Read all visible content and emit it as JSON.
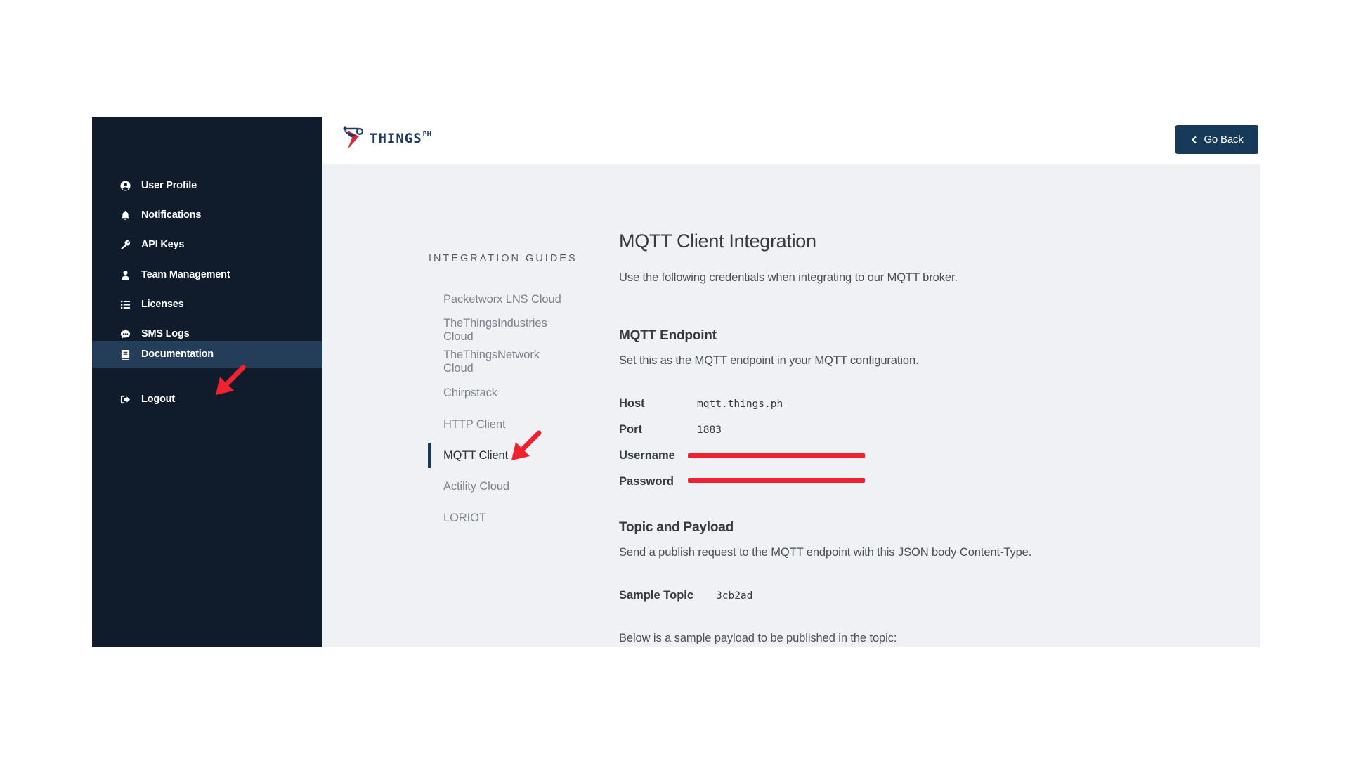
{
  "colors": {
    "sidebar_bg": "#101b2c",
    "sidebar_active": "#243e59",
    "primary_button": "#183a5a",
    "main_bg": "#f0f1f5",
    "annotation_red": "#f0222f"
  },
  "sidebar": {
    "items": [
      {
        "label": "User Profile",
        "icon": "user-circle-icon"
      },
      {
        "label": "Notifications",
        "icon": "bell-icon"
      },
      {
        "label": "API Keys",
        "icon": "key-icon"
      },
      {
        "label": "Team Management",
        "icon": "user-icon"
      },
      {
        "label": "Licenses",
        "icon": "list-icon"
      },
      {
        "label": "SMS Logs",
        "icon": "chat-icon"
      },
      {
        "label": "Documentation",
        "icon": "book-icon",
        "active": true
      },
      {
        "label": "Logout",
        "icon": "logout-icon"
      }
    ]
  },
  "header": {
    "logo_text": "THINGS",
    "logo_sup": "PH",
    "go_back_label": "Go Back"
  },
  "guides": {
    "title": "INTEGRATION GUIDES",
    "items": [
      "Packetworx LNS Cloud",
      "TheThingsIndustries Cloud",
      "TheThingsNetwork Cloud",
      "Chirpstack",
      "HTTP Client",
      "MQTT Client",
      "Actility Cloud",
      "LORIOT"
    ],
    "active": "MQTT Client"
  },
  "content": {
    "title": "MQTT Client Integration",
    "intro": "Use the following credentials when integrating to our MQTT broker.",
    "endpoint_heading": "MQTT Endpoint",
    "endpoint_desc": "Set this as the MQTT endpoint in your MQTT configuration.",
    "host_label": "Host",
    "host_value": "mqtt.things.ph",
    "port_label": "Port",
    "port_value": "1883",
    "username_label": "Username",
    "password_label": "Password",
    "topic_heading": "Topic and Payload",
    "topic_desc": "Send a publish request to the MQTT endpoint with this JSON body Content-Type.",
    "sample_topic_label": "Sample Topic",
    "sample_topic_value": "3cb2ad",
    "payload_intro": "Below is a sample payload to be published in the topic:"
  }
}
